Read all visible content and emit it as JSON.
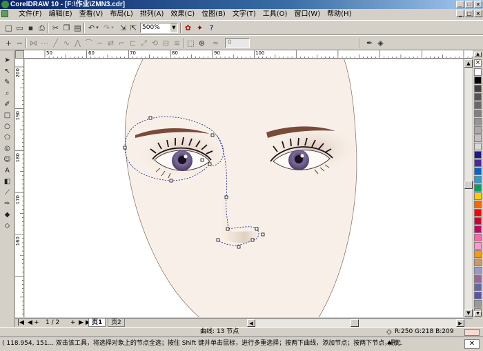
{
  "window": {
    "title": "CorelDRAW 10 - [F:\\作业\\ZMN3.cdr]",
    "min_label": "_",
    "max_label": "□",
    "close_label": "×"
  },
  "menu": {
    "items": [
      "文件(F)",
      "编辑(E)",
      "查看(V)",
      "布局(L)",
      "排列(A)",
      "效果(C)",
      "位图(B)",
      "文字(T)",
      "工具(O)",
      "窗口(W)",
      "帮助(H)"
    ]
  },
  "toolbar": {
    "zoom_value": "500%",
    "node_count_field": "0"
  },
  "rulers": {
    "horizontal_labels": [
      "50",
      "60",
      "70",
      "80",
      "90",
      "100"
    ],
    "vertical_labels": [
      "200",
      "190",
      "180",
      "170",
      "160"
    ]
  },
  "colors": {
    "title_active": "#0a246a",
    "skin": "#f8f0e8",
    "selection_path": "#1e2c8a",
    "brow": "#7a4a38",
    "iris": "#7a6a9a",
    "fill_rgb": "#fad9d1"
  },
  "palette": {
    "swatches": [
      "#ffffff",
      "#000000",
      "#404040",
      "#555555",
      "#6a6a6a",
      "#808080",
      "#959595",
      "#aaaaaa",
      "#c0c0c0",
      "#d8d8d8",
      "#1a1a8a",
      "#4a2a9a",
      "#0066cc",
      "#3399cc",
      "#00a060",
      "#ffcc00",
      "#ff6600",
      "#ff0000",
      "#cc0033",
      "#cc0066",
      "#ff66aa",
      "#ff99cc",
      "#ff9900",
      "#cc9966",
      "#9999cc",
      "#996699",
      "#6666aa",
      "#5555aa",
      "#999999",
      "#bbbbbb"
    ]
  },
  "pagebar": {
    "page_indicator": "1 / 2",
    "tabs": [
      "页1",
      "页2"
    ]
  },
  "status": {
    "object_info": "曲线: 13 节点",
    "fill_info": "R:250 G:218 B:209",
    "coords_hint": "( 118.954, 151... 双击该工具，将选择对象上的节点全选；按住 Shift 键并单击鼠标，进行多重选择；按两下曲线，添加节点；按两下节点，删...",
    "outline_info": "无"
  }
}
